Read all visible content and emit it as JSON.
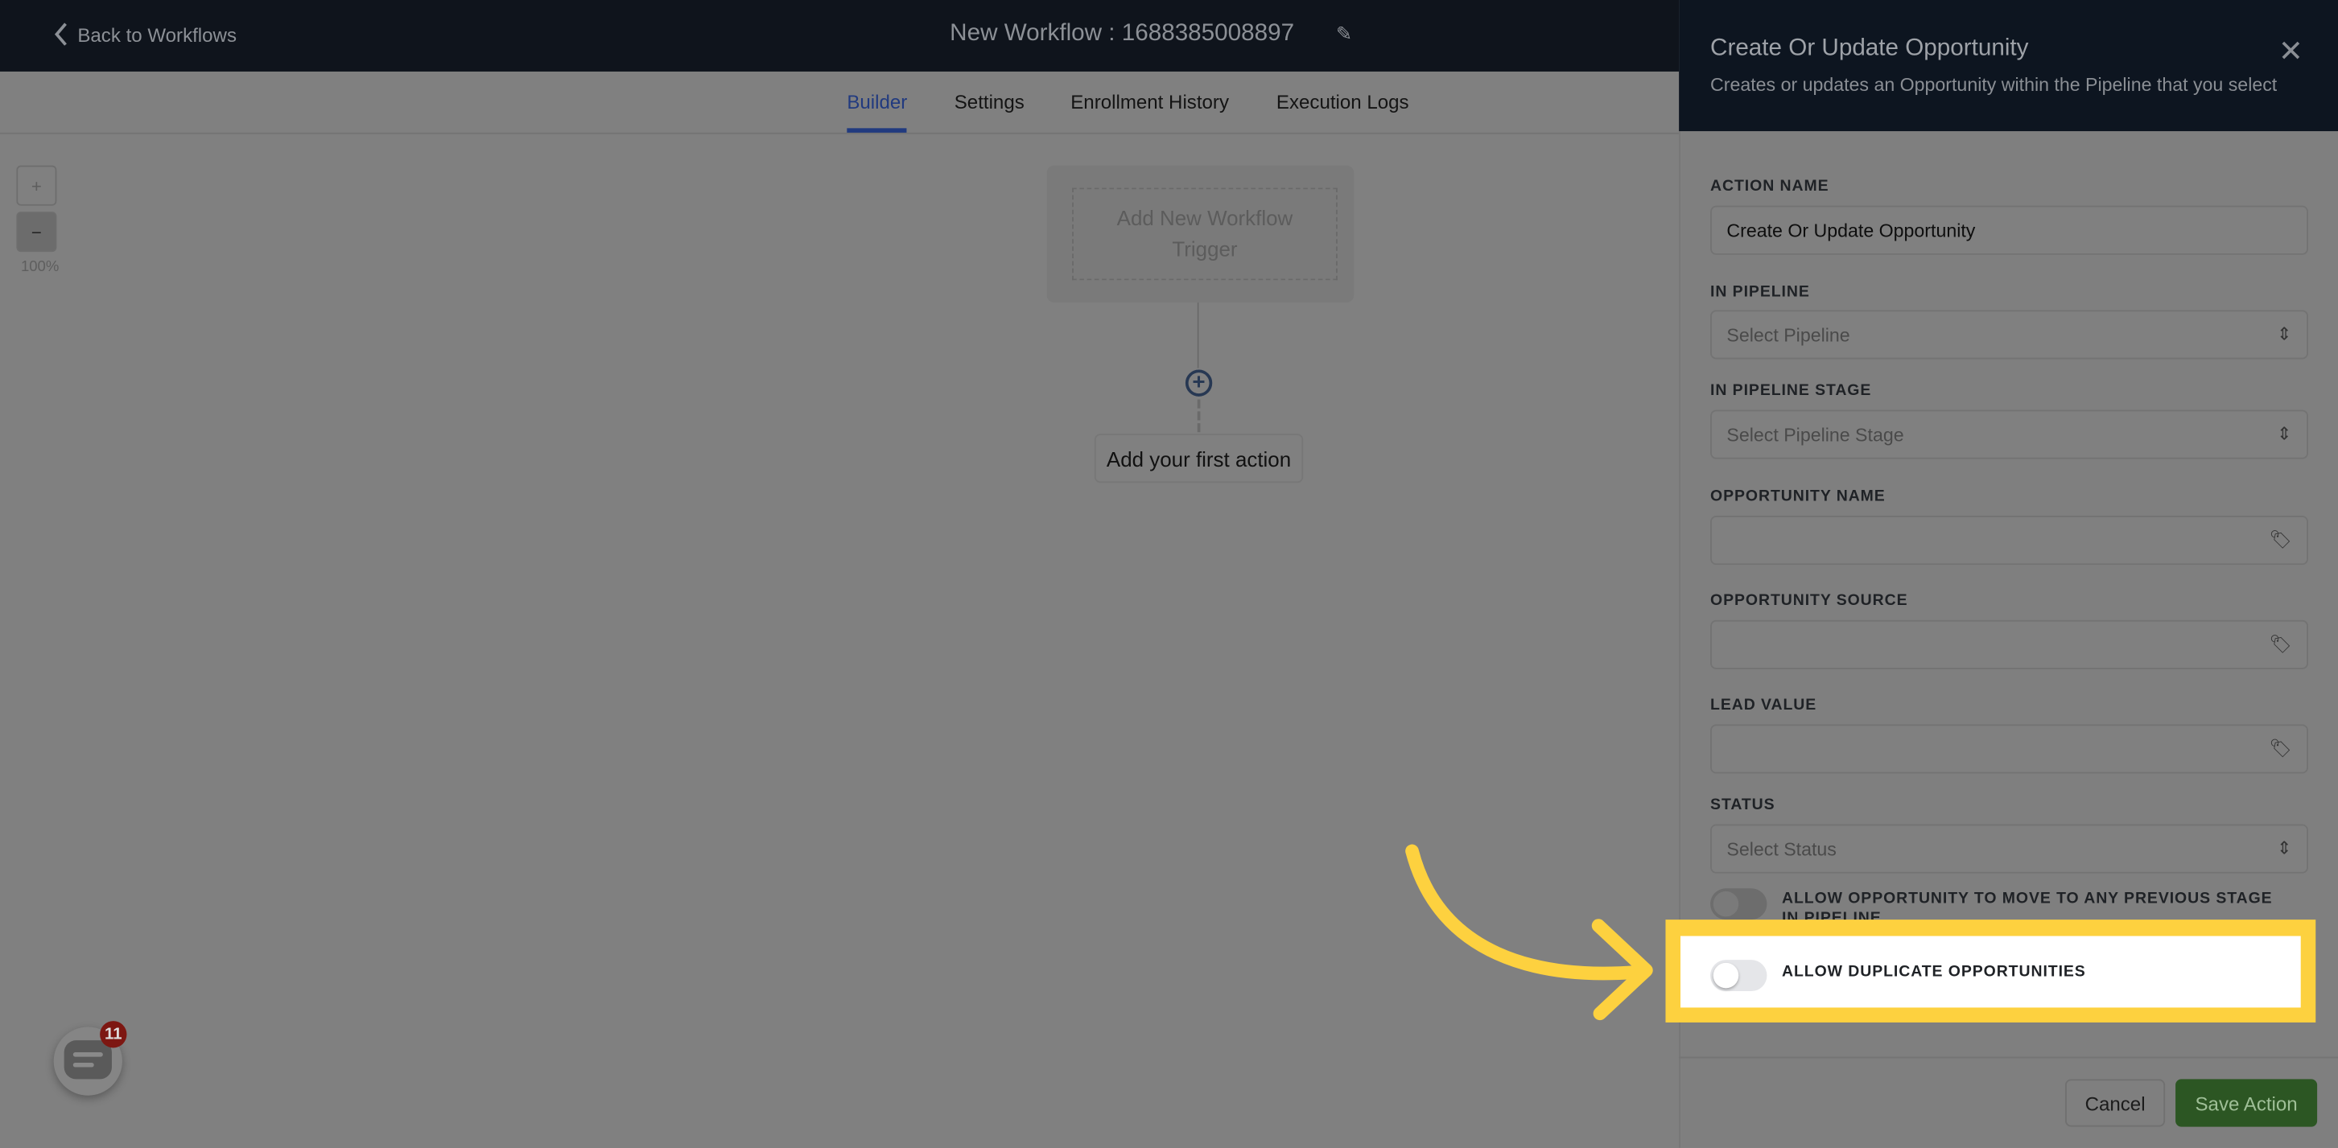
{
  "header": {
    "back_label": "Back to Workflows",
    "title": "New Workflow : 1688385008897"
  },
  "tabs": [
    {
      "label": "Builder",
      "active": true
    },
    {
      "label": "Settings"
    },
    {
      "label": "Enrollment History"
    },
    {
      "label": "Execution Logs"
    }
  ],
  "zoom": {
    "plus": "+",
    "minus": "−",
    "level": "100%"
  },
  "canvas": {
    "trigger_label": "Add New Workflow Trigger",
    "add_action_label": "Add your first action"
  },
  "chat": {
    "badge_count": "11"
  },
  "panel": {
    "title": "Create Or Update Opportunity",
    "subtitle": "Creates or updates an Opportunity within the Pipeline that you select",
    "fields": [
      {
        "label": "ACTION NAME",
        "value": "Create Or Update Opportunity"
      },
      {
        "label": "IN PIPELINE",
        "placeholder": "Select Pipeline"
      },
      {
        "label": "IN PIPELINE STAGE",
        "placeholder": "Select Pipeline Stage"
      },
      {
        "label": "OPPORTUNITY NAME",
        "value": ""
      },
      {
        "label": "OPPORTUNITY SOURCE",
        "value": ""
      },
      {
        "label": "LEAD VALUE",
        "value": ""
      },
      {
        "label": "STATUS",
        "placeholder": "Select Status"
      }
    ],
    "toggles": [
      {
        "label": "ALLOW OPPORTUNITY TO MOVE TO ANY PREVIOUS STAGE IN PIPELINE",
        "on": false
      },
      {
        "label": "ALLOW DUPLICATE OPPORTUNITIES",
        "on": false
      }
    ],
    "cancel_label": "Cancel",
    "save_label": "Save Action"
  },
  "colors": {
    "highlight": "#fdd13f",
    "accent": "#213a7f",
    "save": "#2c5623"
  }
}
